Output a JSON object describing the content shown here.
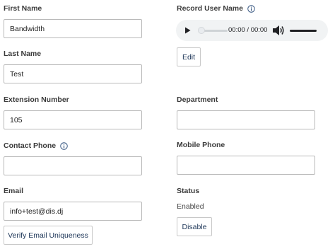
{
  "left_column": {
    "first_name": {
      "label": "First Name",
      "value": "Bandwidth"
    },
    "last_name": {
      "label": "Last Name",
      "value": "Test"
    },
    "extension_number": {
      "label": "Extension Number",
      "value": "105"
    },
    "contact_phone": {
      "label": "Contact Phone",
      "value": ""
    },
    "email": {
      "label": "Email",
      "value": "info+test@dis.dj"
    },
    "verify_email_button": "Verify Email Uniqueness"
  },
  "right_column": {
    "record_user_name": {
      "label": "Record User Name",
      "audio": {
        "time": "00:00 / 00:00",
        "progress": 0,
        "volume": 1
      },
      "edit_button": "Edit"
    },
    "department": {
      "label": "Department",
      "value": ""
    },
    "mobile_phone": {
      "label": "Mobile Phone",
      "value": ""
    },
    "status": {
      "label": "Status",
      "value": "Enabled",
      "disable_button": "Disable"
    }
  },
  "icons": {
    "info": "info-circle-icon",
    "play": "play-icon",
    "volume": "volume-icon"
  },
  "colors": {
    "button_text": "#1c3557",
    "info_icon": "#2b4d7a"
  }
}
